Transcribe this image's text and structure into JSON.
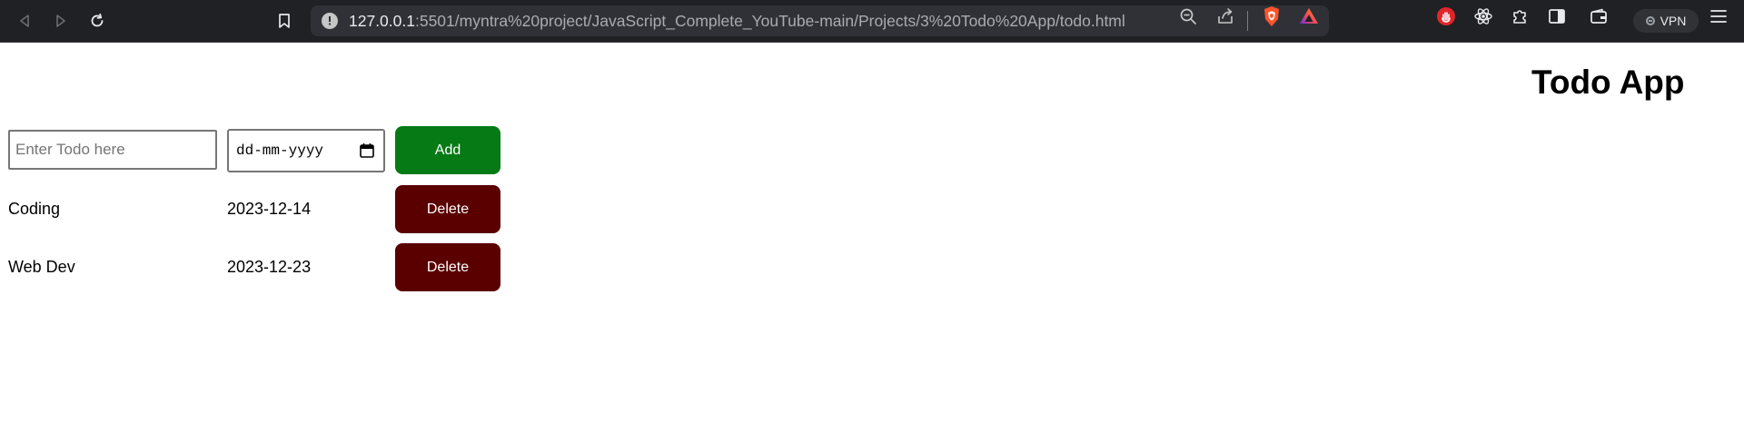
{
  "browser": {
    "url_host": "127.0.0.1",
    "url_rest": ":5501/myntra%20project/JavaScript_Complete_YouTube-main/Projects/3%20Todo%20App/todo.html",
    "vpn_label": "VPN",
    "colors": {
      "toolbar_bg": "#202124",
      "urlbar_bg": "#2f3136",
      "brave_orange": "#fb542b",
      "shield_red": "#e1252a"
    },
    "icons": [
      "back-icon",
      "forward-icon",
      "reload-icon",
      "bookmark-icon",
      "site-info-icon",
      "zoom-out-icon",
      "share-icon",
      "brave-shields-icon",
      "brave-rewards-icon",
      "stop-extension-icon",
      "react-devtools-icon",
      "extensions-icon",
      "sidebar-icon",
      "wallet-icon",
      "menu-icon"
    ]
  },
  "app": {
    "title": "Todo App",
    "todo_input": {
      "placeholder": "Enter Todo here",
      "value": ""
    },
    "date_input": {
      "placeholder": "dd-mm-yyyy",
      "value": ""
    },
    "add_label": "Add",
    "colors": {
      "add": "#067a14",
      "delete": "#5a0000"
    }
  },
  "todos": [
    {
      "name": "Coding",
      "date": "2023-12-14",
      "delete_label": "Delete"
    },
    {
      "name": "Web Dev",
      "date": "2023-12-23",
      "delete_label": "Delete"
    }
  ]
}
